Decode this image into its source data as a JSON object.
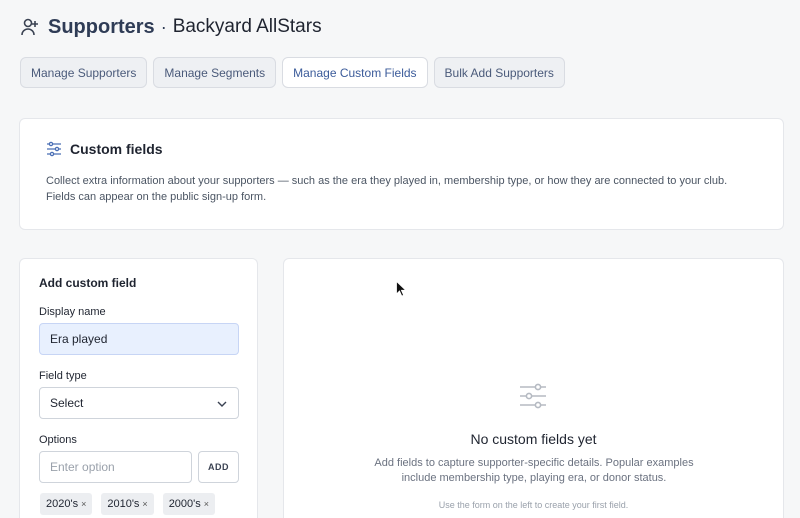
{
  "header": {
    "title": "Supporters",
    "separator": "·",
    "org": "Backyard AllStars"
  },
  "tabs": [
    {
      "label": "Manage Supporters"
    },
    {
      "label": "Manage Segments"
    },
    {
      "label": "Manage Custom Fields"
    },
    {
      "label": "Bulk Add Supporters"
    }
  ],
  "info": {
    "title": "Custom fields",
    "description": "Collect extra information about your supporters — such as the era they played in, membership type, or how they are connected to your club. Fields can appear on the public sign-up form."
  },
  "form": {
    "heading": "Add custom field",
    "display_name_label": "Display name",
    "display_name_value": "Era played",
    "field_type_label": "Field type",
    "field_type_value": "Select",
    "options_label": "Options",
    "option_placeholder": "Enter option",
    "add_label": "ADD",
    "chips": [
      "2020's",
      "2010's",
      "2000's"
    ],
    "chip_remove": "×"
  },
  "empty": {
    "title": "No custom fields yet",
    "description": "Add fields to capture supporter-specific details. Popular examples include membership type, playing era, or donor status.",
    "hint": "Use the form on the left to create your first field."
  },
  "icons": {
    "header": "person-add-icon",
    "info": "sliders-icon",
    "empty": "sliders-icon",
    "select": "chevron-down-icon"
  }
}
